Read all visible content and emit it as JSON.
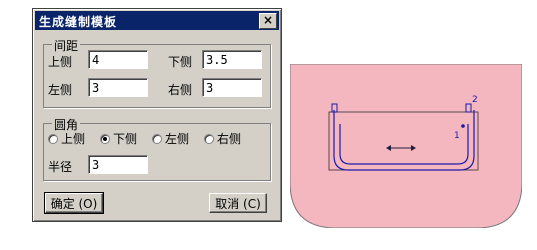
{
  "dialog": {
    "title": "生成缝制模板",
    "close_glyph": "×",
    "spacing": {
      "legend": "间距",
      "top_label": "上侧",
      "top_value": "4",
      "bottom_label": "下侧",
      "bottom_value": "3.5",
      "left_label": "左侧",
      "left_value": "3",
      "right_label": "右侧",
      "right_value": "3"
    },
    "corner": {
      "legend": "圆角",
      "options": [
        {
          "label": "上侧",
          "selected": false
        },
        {
          "label": "下侧",
          "selected": true
        },
        {
          "label": "左侧",
          "selected": false
        },
        {
          "label": "右侧",
          "selected": false
        }
      ],
      "radius_label": "半径",
      "radius_value": "3"
    },
    "ok_label": "确定 (O)",
    "cancel_label": "取消 (C)"
  },
  "drawing": {
    "fill_color": "#f4b6bf",
    "line_color": "#1a1aa8",
    "labels": {
      "one": "1",
      "two": "2"
    }
  }
}
